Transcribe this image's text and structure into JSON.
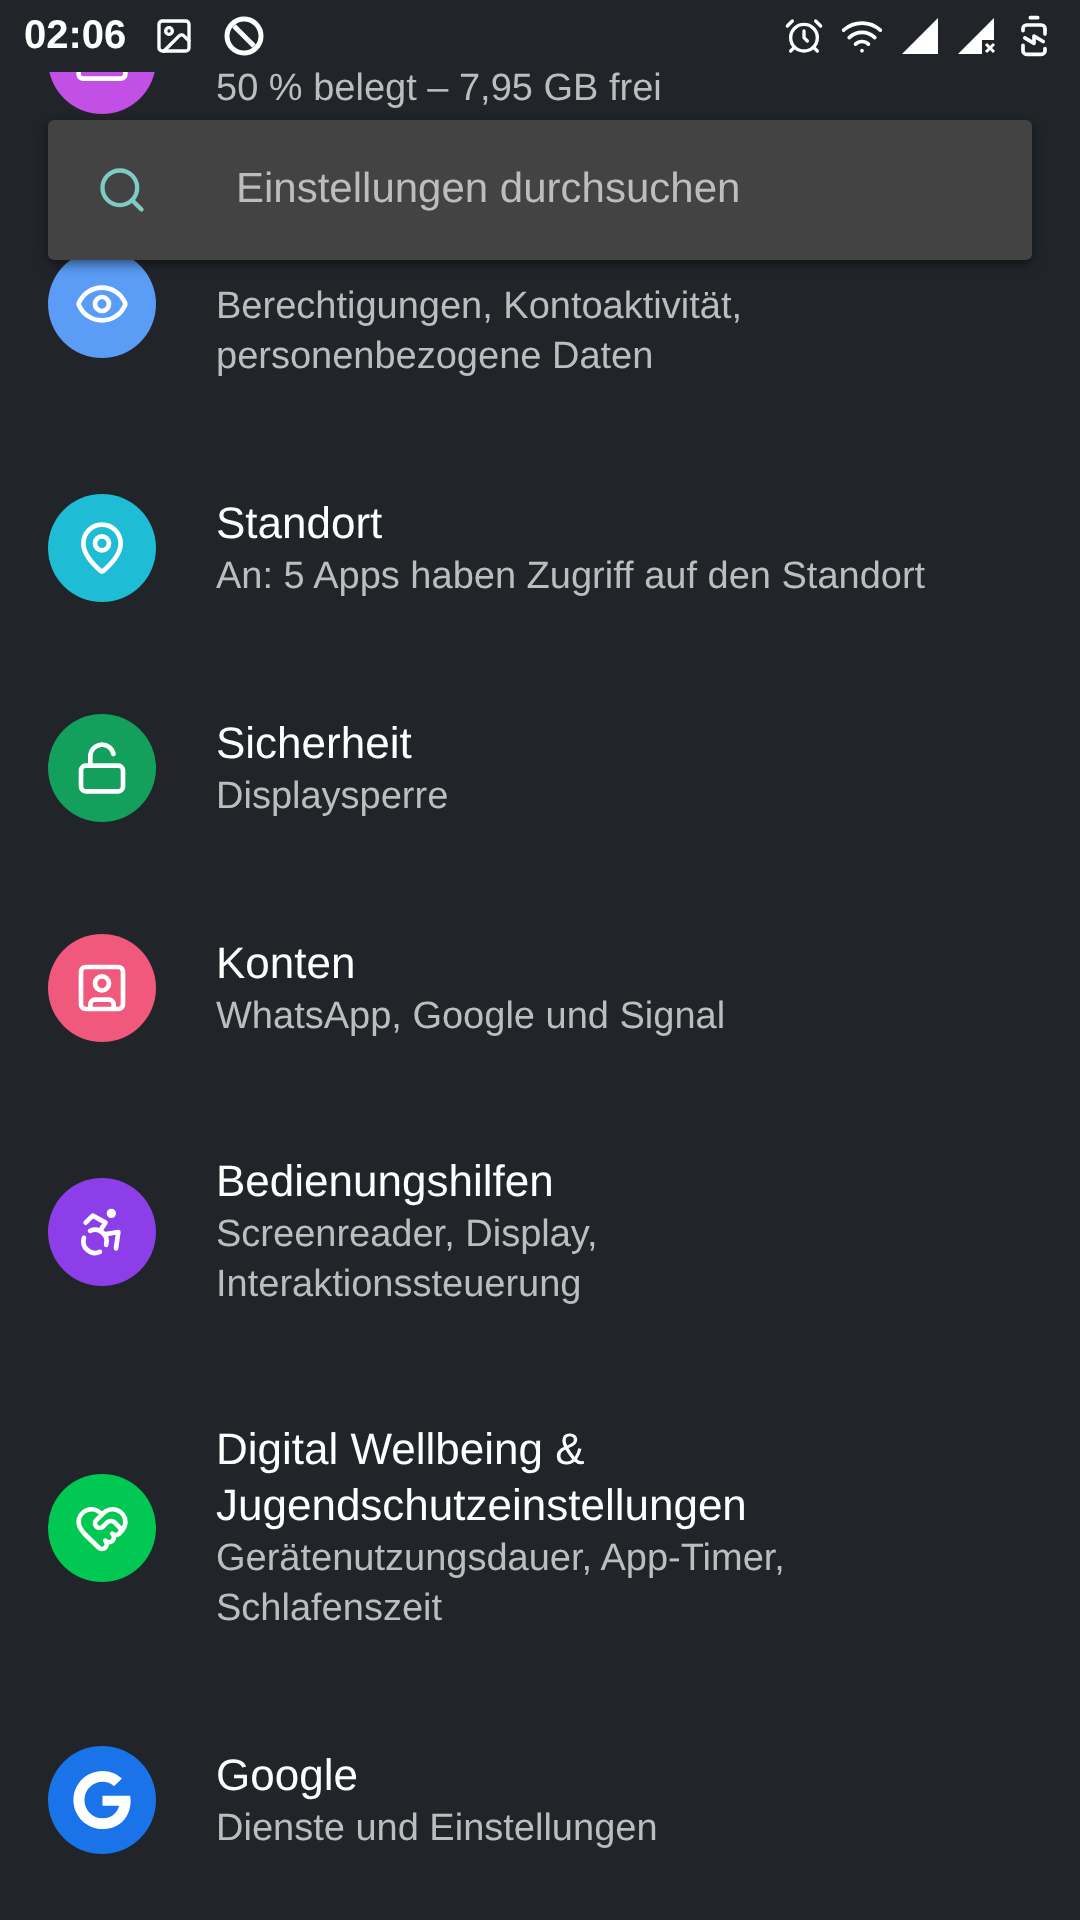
{
  "status_bar": {
    "time": "02:06"
  },
  "search": {
    "placeholder": "Einstellungen durchsuchen"
  },
  "items": [
    {
      "kind": "storage",
      "color": "#c24fe6",
      "subtitle": "50 % belegt – 7,95 GB frei"
    },
    {
      "kind": "privacy",
      "color": "#5b9cf6",
      "subtitle_lines": [
        "Berechtigungen, Kontoaktivität,",
        "personenbezogene Daten"
      ]
    },
    {
      "kind": "location",
      "color": "#1fbcd6",
      "title": "Standort",
      "subtitle": "An: 5 Apps haben Zugriff auf den Standort"
    },
    {
      "kind": "security",
      "color": "#12a05c",
      "title": "Sicherheit",
      "subtitle": "Displaysperre"
    },
    {
      "kind": "accounts",
      "color": "#f0587c",
      "title": "Konten",
      "subtitle": "WhatsApp, Google und Signal"
    },
    {
      "kind": "accessibility",
      "color": "#8c3fe8",
      "title": "Bedienungshilfen",
      "subtitle_lines": [
        "Screenreader, Display,",
        "Interaktionssteuerung"
      ]
    },
    {
      "kind": "wellbeing",
      "color": "#00c853",
      "title": "Digital Wellbeing & Jugendschutzeinstellungen",
      "subtitle_lines": [
        "Gerätenutzungsdauer, App-Timer,",
        "Schlafenszeit"
      ]
    },
    {
      "kind": "google",
      "color": "#1a73e8",
      "title": "Google",
      "subtitle": "Dienste und Einstellungen"
    }
  ]
}
